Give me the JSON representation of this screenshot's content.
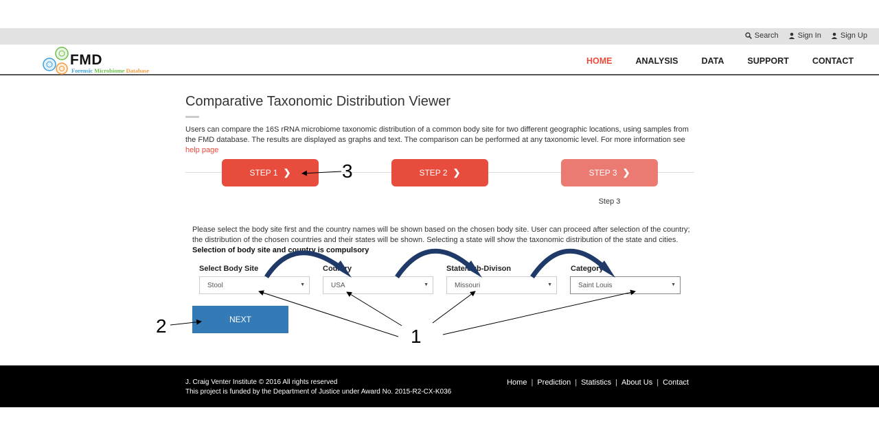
{
  "topbar": {
    "search": "Search",
    "sign_in": "Sign In",
    "sign_up": "Sign Up"
  },
  "logo": {
    "name": "FMD",
    "sub_word1": "Forensic",
    "sub_word2": "Microbiome",
    "sub_word3": "Database"
  },
  "nav": [
    {
      "label": "HOME",
      "active": true
    },
    {
      "label": "ANALYSIS"
    },
    {
      "label": "DATA"
    },
    {
      "label": "SUPPORT"
    },
    {
      "label": "CONTACT"
    }
  ],
  "page": {
    "title": "Comparative Taxonomic Distribution Viewer",
    "intro": "Users can compare the 16S rRNA microbiome taxonomic distribution of a common body site for two different geographic locations, using samples from the FMD database. The results are displayed as graphs and text. The comparison can be performed at any taxonomic level. For more information see",
    "help_link": "help page"
  },
  "steps": [
    {
      "label": "STEP 1",
      "state": "active"
    },
    {
      "label": "STEP 2",
      "state": "active"
    },
    {
      "label": "STEP 3",
      "state": "disabled"
    }
  ],
  "step_caption": "Step 3",
  "instructions": {
    "text": "Please select the body site first and the country names will be shown based on the chosen body site. User can proceed after selection of the country; the distribution of the chosen countries and their states will be shown. Selecting a state will show the taxonomic distribution of the state and cities.",
    "bold": "Selection of body site and country is compulsory"
  },
  "fields": [
    {
      "label": "Select Body Site",
      "value": "Stool"
    },
    {
      "label": "Country",
      "value": "USA"
    },
    {
      "label": "State/Sub-Divison",
      "value": "Missouri"
    },
    {
      "label": "Category",
      "value": "Saint Louis"
    }
  ],
  "next_button": "NEXT",
  "annotations": {
    "a1": "1",
    "a2": "2",
    "a3": "3"
  },
  "footer": {
    "line1": "J. Craig Venter Institute © 2016 All rights reserved",
    "line2": "This project is funded by the Department of Justice under Award No. 2015-R2-CX-K036",
    "links": [
      "Home",
      "Prediction",
      "Statistics",
      "About Us",
      "Contact"
    ],
    "separator": "|"
  },
  "colors": {
    "accent": "#e74c3c",
    "primary_button": "#337ab7",
    "footer_bg": "#000000",
    "curved_arrow": "#1f3a68"
  }
}
